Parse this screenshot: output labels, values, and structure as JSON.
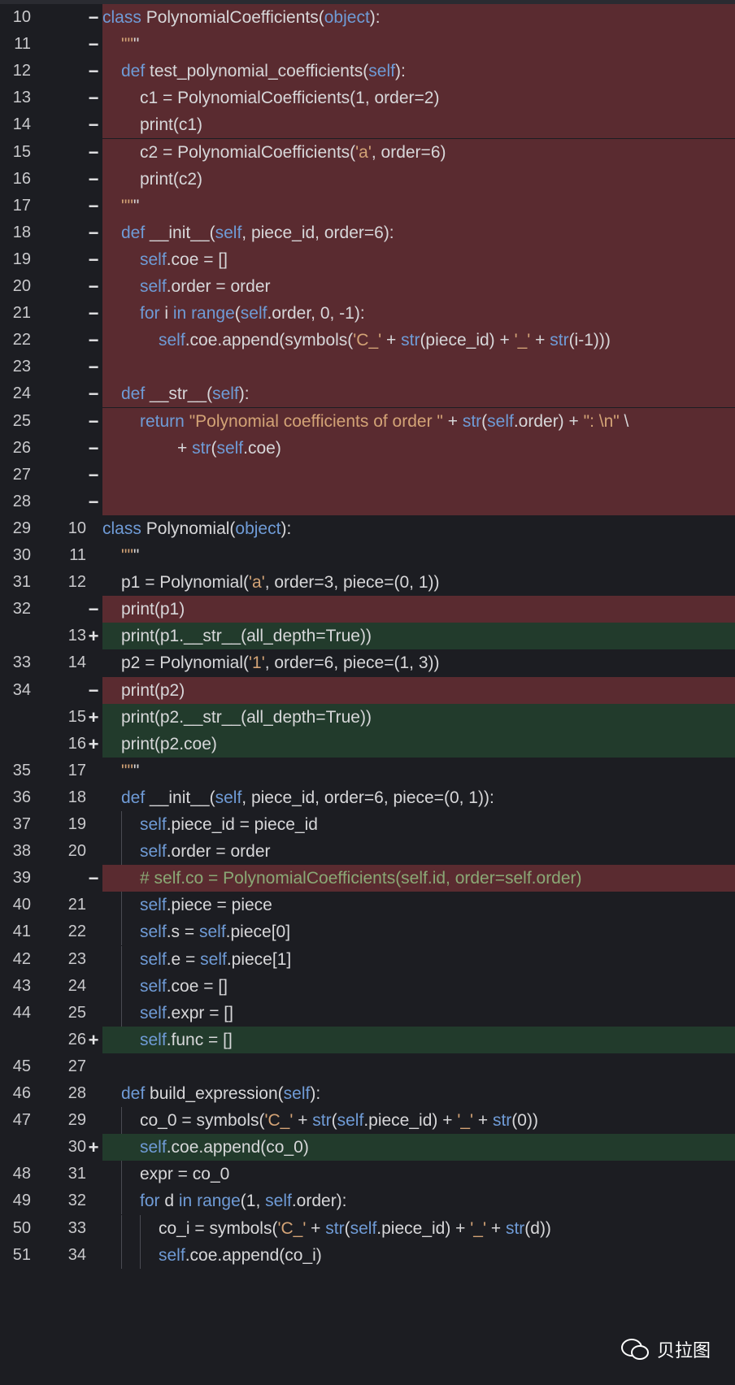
{
  "view": {
    "type": "side-by-side-lineno unified diff",
    "language": "python"
  },
  "colors": {
    "deleted_bg": "#5a2b30",
    "added_bg": "#223b2c",
    "keyword": "#6f9bd6",
    "string": "#d3a376",
    "comment": "#8aa875",
    "builtin": "#6f9bd6",
    "plain": "#d7d7d9"
  },
  "lines": [
    {
      "old": "10",
      "new": "",
      "mark": "−",
      "kind": "del",
      "indent": 0,
      "text": "class PolynomialCoefficients(object):"
    },
    {
      "old": "11",
      "new": "",
      "mark": "−",
      "kind": "del",
      "indent": 1,
      "text": "\"\"\""
    },
    {
      "old": "12",
      "new": "",
      "mark": "−",
      "kind": "del",
      "indent": 1,
      "text": "def test_polynomial_coefficients(self):"
    },
    {
      "old": "13",
      "new": "",
      "mark": "−",
      "kind": "del",
      "indent": 2,
      "text": "c1 = PolynomialCoefficients(1, order=2)"
    },
    {
      "old": "14",
      "new": "",
      "mark": "−",
      "kind": "del",
      "indent": 2,
      "text": "print(c1)"
    },
    {
      "old": "15",
      "new": "",
      "mark": "−",
      "kind": "del",
      "indent": 2,
      "text": "c2 = PolynomialCoefficients('a', order=6)"
    },
    {
      "old": "16",
      "new": "",
      "mark": "−",
      "kind": "del",
      "indent": 2,
      "text": "print(c2)"
    },
    {
      "old": "17",
      "new": "",
      "mark": "−",
      "kind": "del",
      "indent": 1,
      "text": "\"\"\""
    },
    {
      "old": "18",
      "new": "",
      "mark": "−",
      "kind": "del",
      "indent": 1,
      "text": "def __init__(self, piece_id, order=6):"
    },
    {
      "old": "19",
      "new": "",
      "mark": "−",
      "kind": "del",
      "indent": 2,
      "text": "self.coe = []"
    },
    {
      "old": "20",
      "new": "",
      "mark": "−",
      "kind": "del",
      "indent": 2,
      "text": "self.order = order"
    },
    {
      "old": "21",
      "new": "",
      "mark": "−",
      "kind": "del",
      "indent": 2,
      "text": "for i in range(self.order, 0, -1):"
    },
    {
      "old": "22",
      "new": "",
      "mark": "−",
      "kind": "del",
      "indent": 3,
      "text": "self.coe.append(symbols('C_' + str(piece_id) + '_' + str(i-1)))"
    },
    {
      "old": "23",
      "new": "",
      "mark": "−",
      "kind": "del",
      "indent": 0,
      "text": ""
    },
    {
      "old": "24",
      "new": "",
      "mark": "−",
      "kind": "del",
      "indent": 1,
      "text": "def __str__(self):"
    },
    {
      "old": "25",
      "new": "",
      "mark": "−",
      "kind": "del",
      "indent": 2,
      "text": "return \"Polynomial coefficients of order \" + str(self.order) + \": \\n\" \\"
    },
    {
      "old": "26",
      "new": "",
      "mark": "−",
      "kind": "del",
      "indent": 4,
      "text": "+ str(self.coe)"
    },
    {
      "old": "27",
      "new": "",
      "mark": "−",
      "kind": "del",
      "indent": 0,
      "text": ""
    },
    {
      "old": "28",
      "new": "",
      "mark": "−",
      "kind": "del",
      "indent": 0,
      "text": ""
    },
    {
      "old": "29",
      "new": "10",
      "mark": "",
      "kind": "ctx",
      "indent": 0,
      "text": "class Polynomial(object):"
    },
    {
      "old": "30",
      "new": "11",
      "mark": "",
      "kind": "ctx",
      "indent": 1,
      "text": "\"\"\""
    },
    {
      "old": "31",
      "new": "12",
      "mark": "",
      "kind": "ctx",
      "indent": 1,
      "text": "p1 = Polynomial('a', order=3, piece=(0, 1))"
    },
    {
      "old": "32",
      "new": "",
      "mark": "−",
      "kind": "del",
      "indent": 1,
      "text": "print(p1)"
    },
    {
      "old": "",
      "new": "13",
      "mark": "+",
      "kind": "add",
      "indent": 1,
      "text": "print(p1.__str__(all_depth=True))"
    },
    {
      "old": "33",
      "new": "14",
      "mark": "",
      "kind": "ctx",
      "indent": 1,
      "text": "p2 = Polynomial('1', order=6, piece=(1, 3))"
    },
    {
      "old": "34",
      "new": "",
      "mark": "−",
      "kind": "del",
      "indent": 1,
      "text": "print(p2)"
    },
    {
      "old": "",
      "new": "15",
      "mark": "+",
      "kind": "add",
      "indent": 1,
      "text": "print(p2.__str__(all_depth=True))"
    },
    {
      "old": "",
      "new": "16",
      "mark": "+",
      "kind": "add",
      "indent": 1,
      "text": "print(p2.coe)"
    },
    {
      "old": "35",
      "new": "17",
      "mark": "",
      "kind": "ctx",
      "indent": 1,
      "text": "\"\"\""
    },
    {
      "old": "36",
      "new": "18",
      "mark": "",
      "kind": "ctx",
      "indent": 1,
      "text": "def __init__(self, piece_id, order=6, piece=(0, 1)):"
    },
    {
      "old": "37",
      "new": "19",
      "mark": "",
      "kind": "ctx",
      "indent": 2,
      "text": "self.piece_id = piece_id"
    },
    {
      "old": "38",
      "new": "20",
      "mark": "",
      "kind": "ctx",
      "indent": 2,
      "text": "self.order = order"
    },
    {
      "old": "39",
      "new": "",
      "mark": "−",
      "kind": "del",
      "indent": 2,
      "text": "# self.co = PolynomialCoefficients(self.id, order=self.order)"
    },
    {
      "old": "40",
      "new": "21",
      "mark": "",
      "kind": "ctx",
      "indent": 2,
      "text": "self.piece = piece"
    },
    {
      "old": "41",
      "new": "22",
      "mark": "",
      "kind": "ctx",
      "indent": 2,
      "text": "self.s = self.piece[0]"
    },
    {
      "old": "42",
      "new": "23",
      "mark": "",
      "kind": "ctx",
      "indent": 2,
      "text": "self.e = self.piece[1]"
    },
    {
      "old": "43",
      "new": "24",
      "mark": "",
      "kind": "ctx",
      "indent": 2,
      "text": "self.coe = []"
    },
    {
      "old": "44",
      "new": "25",
      "mark": "",
      "kind": "ctx",
      "indent": 2,
      "text": "self.expr = []"
    },
    {
      "old": "",
      "new": "26",
      "mark": "+",
      "kind": "add",
      "indent": 2,
      "text": "self.func = []"
    },
    {
      "old": "45",
      "new": "27",
      "mark": "",
      "kind": "ctx",
      "indent": 0,
      "text": ""
    },
    {
      "old": "46",
      "new": "28",
      "mark": "",
      "kind": "ctx",
      "indent": 1,
      "text": "def build_expression(self):"
    },
    {
      "old": "47",
      "new": "29",
      "mark": "",
      "kind": "ctx",
      "indent": 2,
      "text": "co_0 = symbols('C_' + str(self.piece_id) + '_' + str(0))"
    },
    {
      "old": "",
      "new": "30",
      "mark": "+",
      "kind": "add",
      "indent": 2,
      "text": "self.coe.append(co_0)"
    },
    {
      "old": "48",
      "new": "31",
      "mark": "",
      "kind": "ctx",
      "indent": 2,
      "text": "expr = co_0"
    },
    {
      "old": "49",
      "new": "32",
      "mark": "",
      "kind": "ctx",
      "indent": 2,
      "text": "for d in range(1, self.order):"
    },
    {
      "old": "50",
      "new": "33",
      "mark": "",
      "kind": "ctx",
      "indent": 3,
      "text": "co_i = symbols('C_' + str(self.piece_id) + '_' + str(d))"
    },
    {
      "old": "51",
      "new": "34",
      "mark": "",
      "kind": "ctx",
      "indent": 3,
      "text": "self.coe.append(co_i)"
    }
  ],
  "watermark": {
    "icon": "wechat-icon",
    "text": "贝拉图"
  }
}
